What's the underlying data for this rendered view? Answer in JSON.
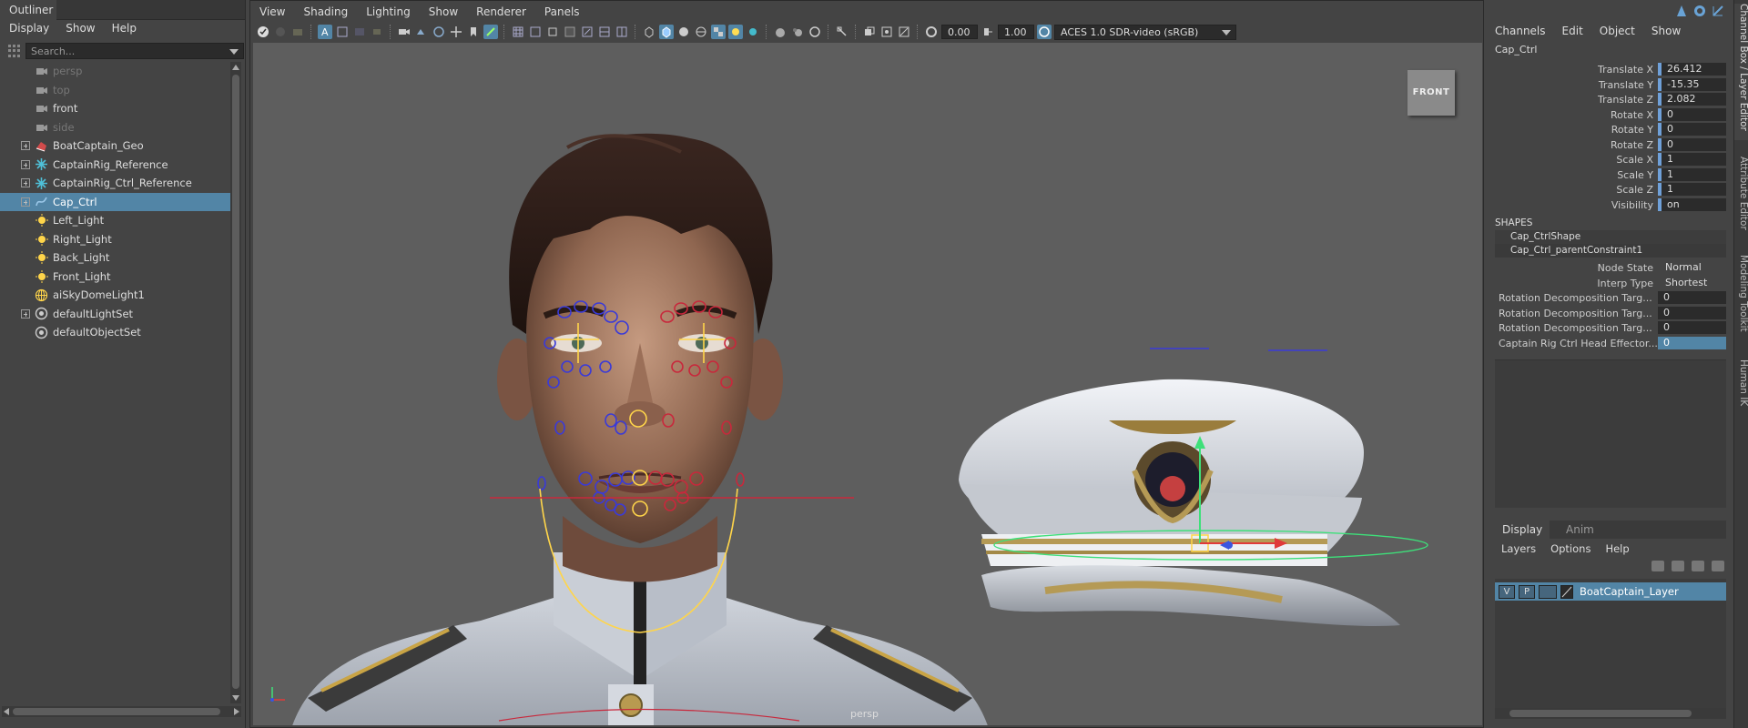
{
  "outliner": {
    "tab": "Outliner",
    "menu": [
      "Display",
      "Show",
      "Help"
    ],
    "search_placeholder": "Search...",
    "items": [
      {
        "label": "persp",
        "type": "camera",
        "dim": true,
        "expandable": false
      },
      {
        "label": "top",
        "type": "camera",
        "dim": true,
        "expandable": false
      },
      {
        "label": "front",
        "type": "camera",
        "dim": false,
        "expandable": false
      },
      {
        "label": "side",
        "type": "camera",
        "dim": true,
        "expandable": false
      },
      {
        "label": "BoatCaptain_Geo",
        "type": "mesh",
        "dim": false,
        "expandable": true
      },
      {
        "label": "CaptainRig_Reference",
        "type": "reference",
        "dim": false,
        "expandable": true
      },
      {
        "label": "CaptainRig_Ctrl_Reference",
        "type": "reference",
        "dim": false,
        "expandable": true
      },
      {
        "label": "Cap_Ctrl",
        "type": "curve",
        "dim": false,
        "expandable": true,
        "selected": true
      },
      {
        "label": "Left_Light",
        "type": "light",
        "dim": false,
        "expandable": false
      },
      {
        "label": "Right_Light",
        "type": "light",
        "dim": false,
        "expandable": false
      },
      {
        "label": "Back_Light",
        "type": "light",
        "dim": false,
        "expandable": false
      },
      {
        "label": "Front_Light",
        "type": "light",
        "dim": false,
        "expandable": false
      },
      {
        "label": "aiSkyDomeLight1",
        "type": "skydome",
        "dim": false,
        "expandable": false
      },
      {
        "label": "defaultLightSet",
        "type": "set",
        "dim": false,
        "expandable": true
      },
      {
        "label": "defaultObjectSet",
        "type": "set",
        "dim": false,
        "expandable": false
      }
    ]
  },
  "viewport": {
    "menu": [
      "View",
      "Shading",
      "Lighting",
      "Show",
      "Renderer",
      "Panels"
    ],
    "exposure": "0.00",
    "gamma": "1.00",
    "color_management": "ACES 1.0 SDR-video (sRGB)",
    "view_cube_label": "FRONT",
    "camera_label": "persp"
  },
  "channelbox": {
    "menu": [
      "Channels",
      "Edit",
      "Object",
      "Show"
    ],
    "object_name": "Cap_Ctrl",
    "attributes": [
      {
        "name": "Translate X",
        "value": "26.412"
      },
      {
        "name": "Translate Y",
        "value": "-15.35"
      },
      {
        "name": "Translate Z",
        "value": "2.082"
      },
      {
        "name": "Rotate X",
        "value": "0"
      },
      {
        "name": "Rotate Y",
        "value": "0"
      },
      {
        "name": "Rotate Z",
        "value": "0"
      },
      {
        "name": "Scale X",
        "value": "1"
      },
      {
        "name": "Scale Y",
        "value": "1"
      },
      {
        "name": "Scale Z",
        "value": "1"
      },
      {
        "name": "Visibility",
        "value": "on"
      }
    ],
    "shapes_header": "SHAPES",
    "shapes": [
      "Cap_CtrlShape",
      "Cap_Ctrl_parentConstraint1"
    ],
    "constraint_attrs": [
      {
        "name": "Node State",
        "value": "Normal"
      },
      {
        "name": "Interp Type",
        "value": "Shortest"
      },
      {
        "name": "Rotation Decomposition Targ...",
        "value": "0"
      },
      {
        "name": "Rotation Decomposition Targ...",
        "value": "0"
      },
      {
        "name": "Rotation Decomposition Targ...",
        "value": "0"
      },
      {
        "name": "Captain Rig Ctrl Head Effector...",
        "value": "0"
      }
    ]
  },
  "layers": {
    "tabs": [
      "Display",
      "Anim"
    ],
    "menu": [
      "Layers",
      "Options",
      "Help"
    ],
    "rows": [
      {
        "v": "V",
        "p": "P",
        "name": "BoatCaptain_Layer"
      }
    ]
  },
  "side_tabs": [
    "Channel Box / Layer Editor",
    "Attribute Editor",
    "Modeling Toolkit",
    "Human IK"
  ],
  "colors": {
    "selection": "#5285a6",
    "background": "#444444",
    "viewport_bg": "#5e5e5e"
  }
}
